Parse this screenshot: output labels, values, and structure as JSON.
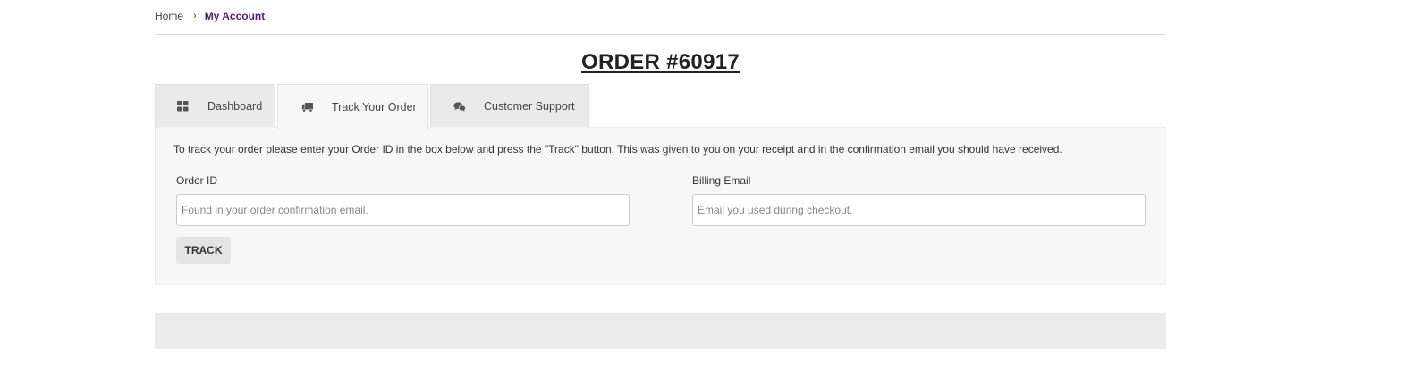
{
  "breadcrumb": {
    "home": "Home",
    "separator": "›",
    "current": "My Account"
  },
  "page": {
    "title": "ORDER #60917"
  },
  "tabs": [
    {
      "label": "Dashboard",
      "icon": "dashboard-grid-icon",
      "active": false
    },
    {
      "label": "Track Your Order",
      "icon": "truck-icon",
      "active": true
    },
    {
      "label": "Customer Support",
      "icon": "chat-bubbles-icon",
      "active": false
    }
  ],
  "track_form": {
    "intro": "To track your order please enter your Order ID in the box below and press the \"Track\" button. This was given to you on your receipt and in the confirmation email you should have received.",
    "order_id_label": "Order ID",
    "order_id_placeholder": "Found in your order confirmation email.",
    "order_id_value": "",
    "email_label": "Billing Email",
    "email_placeholder": "Email you used during checkout.",
    "email_value": "",
    "submit_label": "TRACK"
  },
  "colors": {
    "accent": "#5a1a78",
    "panel_bg": "#f7f7f7",
    "tab_bg": "#eaeaea",
    "button_bg": "#e4e4e4"
  }
}
